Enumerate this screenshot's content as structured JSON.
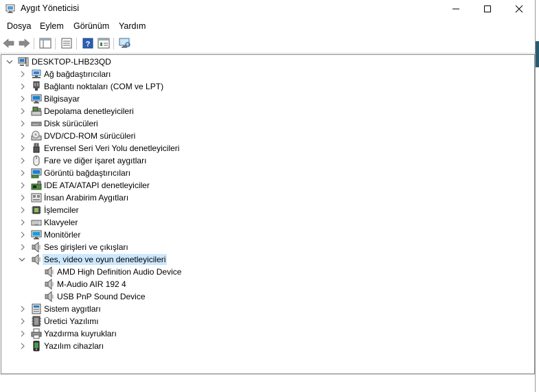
{
  "window": {
    "title": "Aygıt Yöneticisi"
  },
  "menu": [
    "Dosya",
    "Eylem",
    "Görünüm",
    "Yardım"
  ],
  "tree": {
    "root": "DESKTOP-LHB23QD",
    "items": [
      {
        "label": "Ağ bağdaştırıcıları",
        "icon": "network-adapter-icon"
      },
      {
        "label": "Bağlantı noktaları (COM ve LPT)",
        "icon": "port-icon"
      },
      {
        "label": "Bilgisayar",
        "icon": "computer-icon"
      },
      {
        "label": "Depolama denetleyicileri",
        "icon": "storage-controller-icon"
      },
      {
        "label": "Disk sürücüleri",
        "icon": "disk-drive-icon"
      },
      {
        "label": "DVD/CD-ROM sürücüleri",
        "icon": "dvd-drive-icon"
      },
      {
        "label": "Evrensel Seri Veri Yolu denetleyicileri",
        "icon": "usb-icon"
      },
      {
        "label": "Fare ve diğer işaret aygıtları",
        "icon": "mouse-icon"
      },
      {
        "label": "Görüntü bağdaştırıcıları",
        "icon": "display-adapter-icon"
      },
      {
        "label": "IDE ATA/ATAPI denetleyiciler",
        "icon": "ide-controller-icon"
      },
      {
        "label": "İnsan Arabirim Aygıtları",
        "icon": "hid-icon"
      },
      {
        "label": "İşlemciler",
        "icon": "processor-icon"
      },
      {
        "label": "Klavyeler",
        "icon": "keyboard-icon"
      },
      {
        "label": "Monitörler",
        "icon": "monitor-icon"
      },
      {
        "label": "Ses girişleri ve çıkışları",
        "icon": "speaker-icon"
      },
      {
        "label": "Ses, video ve oyun denetleyicileri",
        "icon": "speaker-icon",
        "expanded": true,
        "selected": true
      },
      {
        "label": "AMD High Definition Audio Device",
        "icon": "speaker-icon",
        "child": true
      },
      {
        "label": "M-Audio AIR 192 4",
        "icon": "speaker-icon",
        "child": true
      },
      {
        "label": "USB PnP Sound Device",
        "icon": "speaker-icon",
        "child": true
      },
      {
        "label": "Sistem aygıtları",
        "icon": "system-device-icon"
      },
      {
        "label": "Üretici Yazılımı",
        "icon": "firmware-icon"
      },
      {
        "label": "Yazdırma kuyrukları",
        "icon": "printer-icon"
      },
      {
        "label": "Yazılım cihazları",
        "icon": "software-device-icon"
      }
    ]
  },
  "colors": {
    "selection": "#cce8ff",
    "accent_blue": "#1e78c8"
  }
}
